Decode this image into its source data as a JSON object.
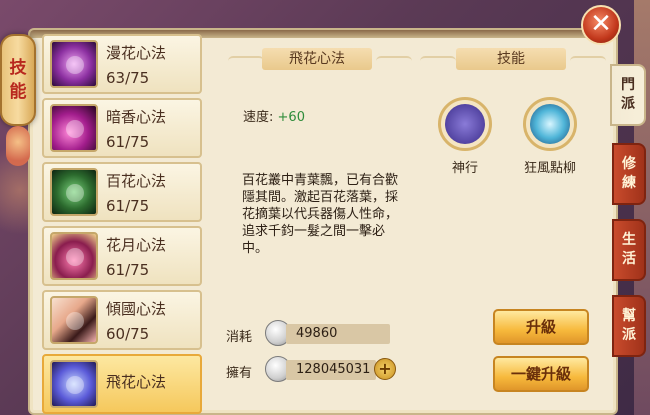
{
  "side_banner": {
    "label_line1": "技",
    "label_line2": "能"
  },
  "skills": [
    {
      "name": "漫花心法",
      "level": "63/75",
      "icon": "flower-swirl-icon"
    },
    {
      "name": "暗香心法",
      "level": "61/75",
      "icon": "pink-wave-icon"
    },
    {
      "name": "百花心法",
      "level": "61/75",
      "icon": "green-hand-icon"
    },
    {
      "name": "花月心法",
      "level": "61/75",
      "icon": "moon-rose-icon"
    },
    {
      "name": "傾國心法",
      "level": "60/75",
      "icon": "beauty-portrait-icon"
    },
    {
      "name": "飛花心法",
      "level": "",
      "icon": "blue-mist-icon"
    }
  ],
  "detail": {
    "title": "飛花心法",
    "speed_label": "速度:",
    "speed_value": "+60",
    "description": "百花叢中青葉飄，已有合歡隱其間。激起百花落葉，採花摘葉以代兵器傷人性命，追求千鈞一髮之間一擊必中。"
  },
  "abilities_section": {
    "title": "技能",
    "items": [
      {
        "label": "神行",
        "icon": "boots-icon"
      },
      {
        "label": "狂風點柳",
        "icon": "whirlwind-icon"
      }
    ]
  },
  "cost": {
    "consume_label": "消耗",
    "consume_value": "49860",
    "own_label": "擁有",
    "own_value": "128045031",
    "plus_symbol": "+"
  },
  "buttons": {
    "upgrade": "升級",
    "one_click_upgrade": "一鍵升級"
  },
  "tabs": [
    {
      "line1": "門",
      "line2": "派"
    },
    {
      "line1": "修",
      "line2": "練"
    },
    {
      "line1": "生",
      "line2": "活"
    },
    {
      "line1": "幫",
      "line2": "派"
    }
  ],
  "close_symbol": "✕",
  "colors": {
    "accent_red": "#c94b2c",
    "panel_bg": "#f3ead4",
    "speed_green": "#2e8c3a",
    "button_gold": "#f7b93c"
  }
}
